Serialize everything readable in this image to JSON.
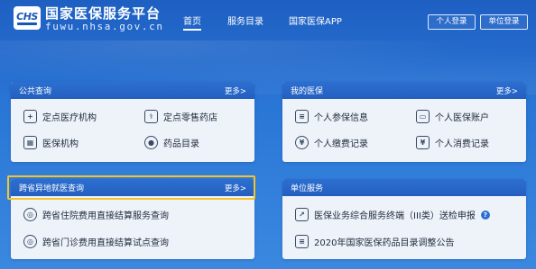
{
  "header": {
    "logo_badge": "CHS",
    "site_title": "国家医保服务平台",
    "site_url": "fuwu.nhsa.gov.cn",
    "nav": [
      "首页",
      "服务目录",
      "国家医保APP"
    ],
    "login_personal": "个人登录",
    "login_unit": "单位登录"
  },
  "public_query": {
    "title": "公共查询",
    "more": "更多>",
    "items": [
      {
        "label": "定点医疗机构",
        "icon": "hospital-icon"
      },
      {
        "label": "定点零售药店",
        "icon": "pharmacy-icon"
      },
      {
        "label": "医保机构",
        "icon": "org-icon"
      },
      {
        "label": "药品目录",
        "icon": "medicine-icon"
      }
    ]
  },
  "my_insurance": {
    "title": "我的医保",
    "more": "更多>",
    "items": [
      {
        "label": "个人参保信息",
        "icon": "insured-info-icon"
      },
      {
        "label": "个人医保账户",
        "icon": "account-icon"
      },
      {
        "label": "个人缴费记录",
        "icon": "payment-icon"
      },
      {
        "label": "个人消费记录",
        "icon": "consumption-icon"
      }
    ]
  },
  "cross_province": {
    "title": "跨省异地就医查询",
    "more": "更多>",
    "items": [
      {
        "label": "跨省住院费用直接结算服务查询",
        "icon": "inpatient-icon"
      },
      {
        "label": "跨省门诊费用直接结算试点查询",
        "icon": "outpatient-icon"
      }
    ]
  },
  "unit_service": {
    "title": "单位服务",
    "items": [
      {
        "label": "医保业务综合服务终端（III类）送检申报",
        "icon": "terminal-icon"
      },
      {
        "label": "2020年国家医保药品目录调整公告",
        "icon": "announcement-icon"
      }
    ],
    "help": "?"
  },
  "colors": {
    "background": "#2a76d6",
    "card_header": "#2c6fd0",
    "card_body": "#eef3fa",
    "highlight": "#f4c52a"
  }
}
